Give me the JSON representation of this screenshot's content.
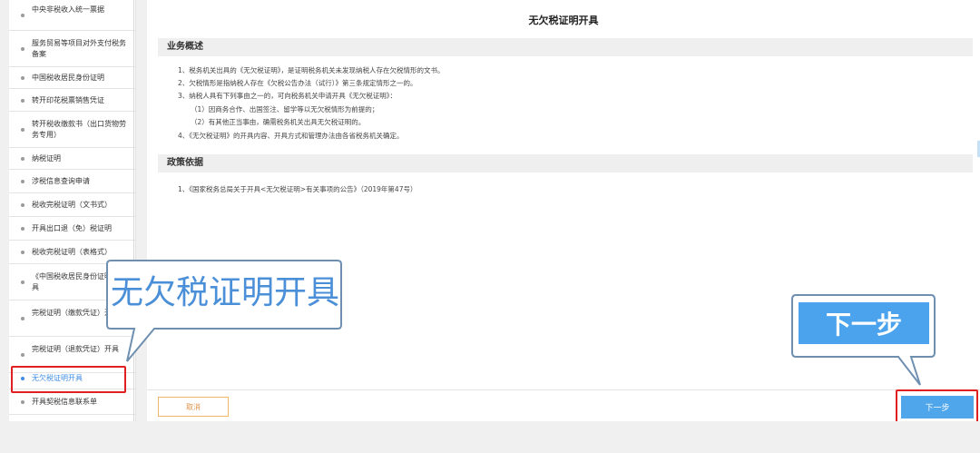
{
  "sidebar": {
    "items": [
      {
        "label": "中央非税收入统一票据"
      },
      {
        "label": "服务贸易等项目对外支付税务备案"
      },
      {
        "label": "中国税收居民身份证明"
      },
      {
        "label": "转开印花税票销售凭证"
      },
      {
        "label": "转开税收缴款书（出口货物劳务专用）"
      },
      {
        "label": "纳税证明"
      },
      {
        "label": "涉税信息查询申请"
      },
      {
        "label": "税收完税证明（文书式）"
      },
      {
        "label": "开具出口退（免）税证明"
      },
      {
        "label": "税收完税证明（表格式）"
      },
      {
        "label": "《中国税收居民身份证明》开具"
      },
      {
        "label": "完税证明（缴款凭证）开具"
      },
      {
        "label": "完税证明（退款凭证）开具"
      },
      {
        "label": "无欠税证明开具"
      },
      {
        "label": "开具契税信息联系单"
      }
    ],
    "active_index": 13
  },
  "main": {
    "title": "无欠税证明开具",
    "section1": {
      "heading": "业务概述",
      "lines": [
        "1、税务机关出具的《无欠税证明》，是证明税务机关未发现纳税人存在欠税情形的文书。",
        "2、欠税情形是指纳税人存在《欠税公告办法（试行）》第三条规定情形之一的。",
        "3、纳税人具有下列事由之一的，可向税务机关申请开具《无欠税证明》：",
        "（1）因商务合作、出国签注、留学等以无欠税情形为前提的；",
        "（2）有其他正当事由，确需税务机关出具无欠税证明的。",
        "4、《无欠税证明》的开具内容、开具方式和管理办法由各省税务机关确定。"
      ]
    },
    "section2": {
      "heading": "政策依据",
      "lines": [
        "1、《国家税务总局关于开具<无欠税证明>有关事项的公告》（2019年第47号）"
      ]
    }
  },
  "footer": {
    "cancel_label": "取消",
    "next_label": "下一步"
  },
  "annotations": {
    "left_callout": "无欠税证明开具",
    "right_callout": "下一步",
    "highlight_color": "#e02020",
    "callout_color": "#4a8fd8"
  }
}
